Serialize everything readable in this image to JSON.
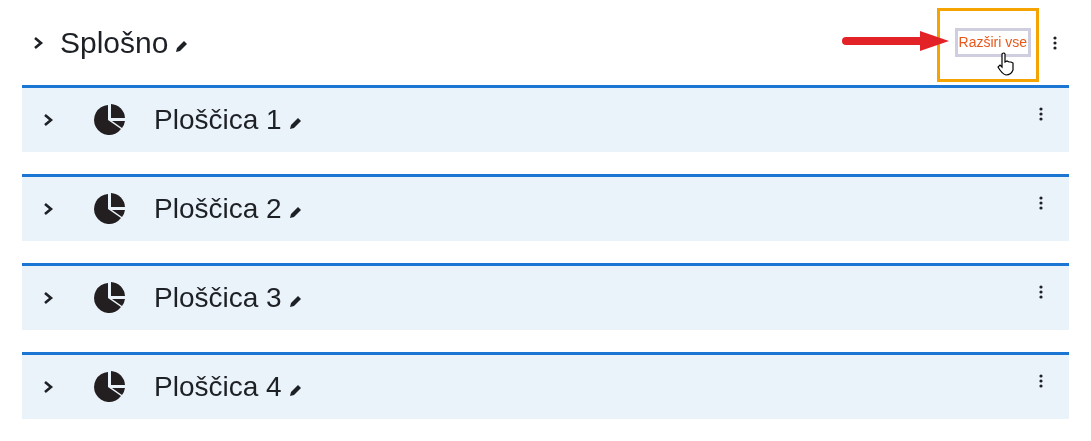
{
  "section": {
    "title": "Splošno",
    "expand_all_button": "Razširi vse"
  },
  "tiles": [
    {
      "title": "Ploščica 1"
    },
    {
      "title": "Ploščica 2"
    },
    {
      "title": "Ploščica 3"
    },
    {
      "title": "Ploščica 4"
    }
  ]
}
